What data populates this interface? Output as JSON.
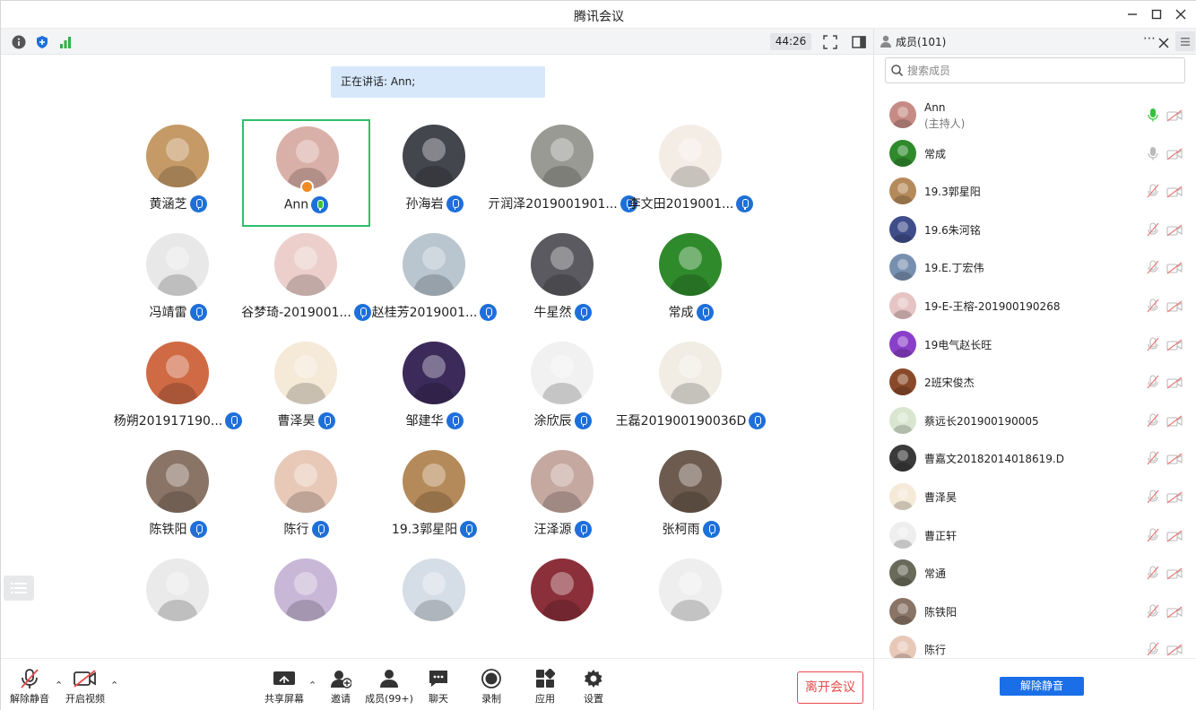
{
  "window": {
    "title": "腾讯会议"
  },
  "toolbar": {
    "timer": "44:26"
  },
  "stage": {
    "speaking": "正在讲话: Ann;",
    "tiles": [
      {
        "name": "黄涵芝",
        "color": "#c59a66"
      },
      {
        "name": "Ann",
        "color": "#d9b0a8",
        "active": true
      },
      {
        "name": "孙海岩",
        "color": "#44464e"
      },
      {
        "name": "亓润泽2019001901...",
        "color": "#9a9a94"
      },
      {
        "name": "李文田2019001...",
        "color": "#f4ede6"
      },
      {
        "name": "冯靖雷",
        "color": "#e8e8e8"
      },
      {
        "name": "谷梦琦-2019001...",
        "color": "#eccfcb"
      },
      {
        "name": "赵桂芳2019001...",
        "color": "#b9c5cf"
      },
      {
        "name": "牛星然",
        "color": "#5a5a60"
      },
      {
        "name": "常成",
        "color": "#2f8a2c"
      },
      {
        "name": "杨朔201917190...",
        "color": "#cf6a45"
      },
      {
        "name": "曹泽昊",
        "color": "#f5e9d8"
      },
      {
        "name": "邹建华",
        "color": "#3b2a5a"
      },
      {
        "name": "涂欣辰",
        "color": "#f1f1f1"
      },
      {
        "name": "王磊201900190036D",
        "color": "#f1ede4"
      },
      {
        "name": "陈铁阳",
        "color": "#8a7466"
      },
      {
        "name": "陈行",
        "color": "#e8c9b8"
      },
      {
        "name": "19.3郭星阳",
        "color": "#b58a5a"
      },
      {
        "name": "汪泽源",
        "color": "#c5a8a0"
      },
      {
        "name": "张柯雨",
        "color": "#6d5b4f"
      },
      {
        "name": "",
        "color": "#eaeaea"
      },
      {
        "name": "",
        "color": "#c9b7d8"
      },
      {
        "name": "",
        "color": "#d5dde6"
      },
      {
        "name": "",
        "color": "#8b2f3a"
      },
      {
        "name": "",
        "color": "#eeeeee"
      }
    ]
  },
  "bottombar": {
    "unmute": "解除静音",
    "start_video": "开启视频",
    "share_screen": "共享屏幕",
    "invite": "邀请",
    "members": "成员(99+)",
    "chat": "聊天",
    "record": "录制",
    "apps": "应用",
    "settings": "设置",
    "leave": "离开会议"
  },
  "panel": {
    "title": "成员(101)",
    "search_placeholder": "搜索成员",
    "members": [
      {
        "name": "Ann",
        "sub": "(主持人)",
        "color": "#c68b84",
        "mic": "on"
      },
      {
        "name": "常成",
        "color": "#2f8a2c",
        "mic": "idle"
      },
      {
        "name": "19.3郭星阳",
        "color": "#b58a5a",
        "mic": "muted"
      },
      {
        "name": "19.6朱河铭",
        "color": "#3f4e8a",
        "mic": "muted"
      },
      {
        "name": "19.E.丁宏伟",
        "color": "#7890b0",
        "mic": "muted"
      },
      {
        "name": "19-E-王榕-201900190268",
        "color": "#e6c4c4",
        "mic": "muted"
      },
      {
        "name": "19电气赵长旺",
        "color": "#8a3fc9",
        "mic": "muted"
      },
      {
        "name": "2班宋俊杰",
        "color": "#8a4a2a",
        "mic": "muted"
      },
      {
        "name": "蔡远长201900190005",
        "color": "#d8e6d0",
        "mic": "muted"
      },
      {
        "name": "曹嘉文20182014018619.D",
        "color": "#3a3a3a",
        "mic": "muted"
      },
      {
        "name": "曹泽昊",
        "color": "#f5e9d8",
        "mic": "muted"
      },
      {
        "name": "曹正轩",
        "color": "#eeeeee",
        "mic": "muted"
      },
      {
        "name": "常通",
        "color": "#6a6a5a",
        "mic": "muted"
      },
      {
        "name": "陈铁阳",
        "color": "#8a7466",
        "mic": "muted"
      },
      {
        "name": "陈行",
        "color": "#e8c9b8",
        "mic": "muted"
      }
    ],
    "unmute_all": "解除静音"
  },
  "colors": {
    "accent": "#1a6fe8",
    "active_border": "#2fbf6b",
    "leave": "#e84a4a"
  }
}
